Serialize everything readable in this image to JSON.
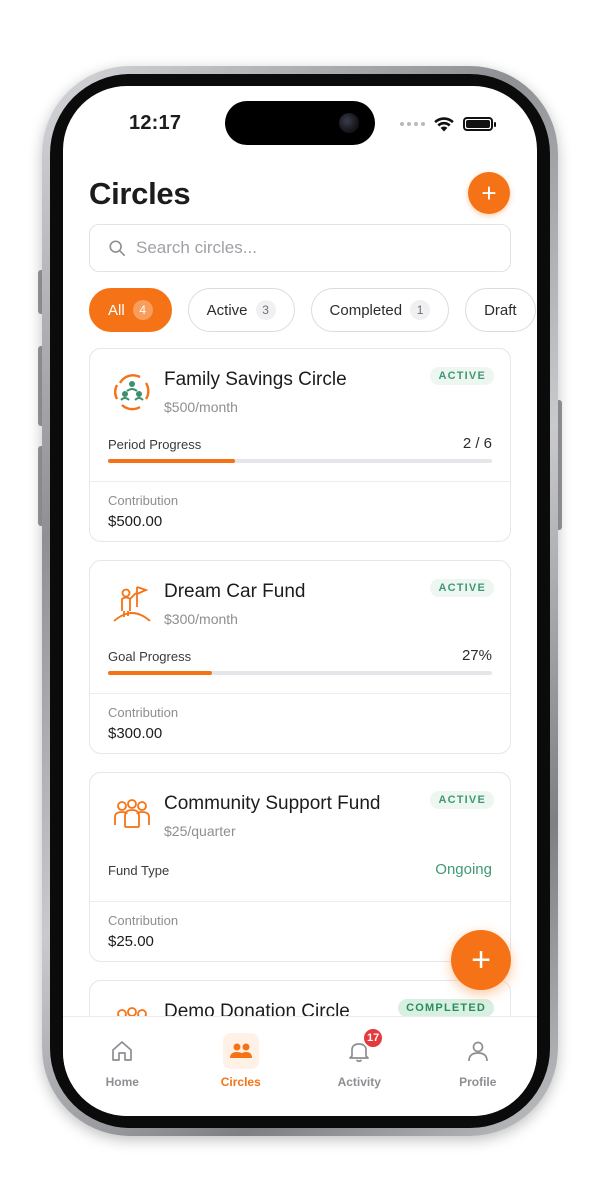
{
  "status_bar": {
    "time": "12:17"
  },
  "header": {
    "title": "Circles",
    "add_label": "+"
  },
  "search": {
    "placeholder": "Search circles..."
  },
  "filters": [
    {
      "label": "All",
      "count": "4",
      "active": true
    },
    {
      "label": "Active",
      "count": "3",
      "active": false
    },
    {
      "label": "Completed",
      "count": "1",
      "active": false
    },
    {
      "label": "Draft",
      "count": "",
      "active": false
    }
  ],
  "cards": [
    {
      "title": "Family Savings Circle",
      "subtitle": "$500/month",
      "status": "ACTIVE",
      "icon": "group-cycle-icon",
      "progress_label": "Period Progress",
      "progress_value": "2 / 6",
      "progress_fraction": 0.33,
      "contribution_label": "Contribution",
      "contribution_value": "$500.00"
    },
    {
      "title": "Dream Car Fund",
      "subtitle": "$300/month",
      "status": "ACTIVE",
      "icon": "goal-flag-icon",
      "progress_label": "Goal Progress",
      "progress_value": "27%",
      "progress_fraction": 0.27,
      "contribution_label": "Contribution",
      "contribution_value": "$300.00"
    },
    {
      "title": "Community Support Fund",
      "subtitle": "$25/quarter",
      "status": "ACTIVE",
      "icon": "community-icon",
      "fund_type_label": "Fund Type",
      "fund_type_value": "Ongoing",
      "contribution_label": "Contribution",
      "contribution_value": "$25.00"
    },
    {
      "title": "Demo Donation Circle",
      "status": "COMPLETED",
      "icon": "community-icon"
    }
  ],
  "fab": {
    "label": "+"
  },
  "tabbar": [
    {
      "label": "Home",
      "icon": "home-icon",
      "active": false
    },
    {
      "label": "Circles",
      "icon": "people-icon",
      "active": true
    },
    {
      "label": "Activity",
      "icon": "bell-icon",
      "active": false,
      "badge": "17"
    },
    {
      "label": "Profile",
      "icon": "person-icon",
      "active": false
    }
  ],
  "colors": {
    "accent": "#f57316",
    "active_badge_text": "#3e9a74",
    "notification": "#e5393c"
  }
}
